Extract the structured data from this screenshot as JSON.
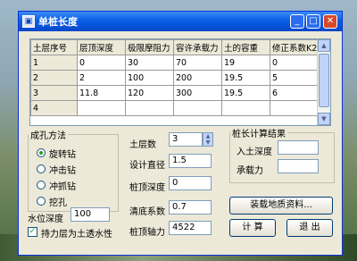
{
  "window": {
    "title": "单桩长度",
    "icon": "app-icon"
  },
  "table": {
    "columns": [
      "土层序号",
      "层顶深度",
      "极限摩阻力",
      "容许承载力",
      "土的容重",
      "修正系数K2"
    ],
    "rows": [
      [
        "1",
        "0",
        "30",
        "70",
        "19",
        "0"
      ],
      [
        "2",
        "2",
        "100",
        "200",
        "19.5",
        "5"
      ],
      [
        "3",
        "11.8",
        "120",
        "300",
        "19.5",
        "6"
      ],
      [
        "4",
        "",
        "",
        "",
        "",
        ""
      ]
    ]
  },
  "hole_method": {
    "legend": "成孔方法",
    "options": [
      "旋转钻",
      "冲击钻",
      "冲抓钻",
      "挖孔"
    ],
    "selected": "旋转钻"
  },
  "params": {
    "layers_label": "土层数",
    "layers_value": "3",
    "diameter_label": "设计直径",
    "diameter_value": "1.5",
    "top_depth_label": "桩顶深度",
    "top_depth_value": "0",
    "clean_label": "清底系数",
    "clean_value": "0.7",
    "axial_label": "桩顶轴力",
    "axial_value": "4522"
  },
  "water": {
    "label": "水位深度",
    "value": "100"
  },
  "bearing_layer": {
    "label": "持力层为土透水性",
    "checked": true
  },
  "result": {
    "legend": "桩长计算结果",
    "depth_label": "入土深度",
    "depth_value": "",
    "capacity_label": "承载力",
    "capacity_value": ""
  },
  "buttons": {
    "load": "装载地质资料...",
    "calc": "计 算",
    "exit": "退 出"
  }
}
